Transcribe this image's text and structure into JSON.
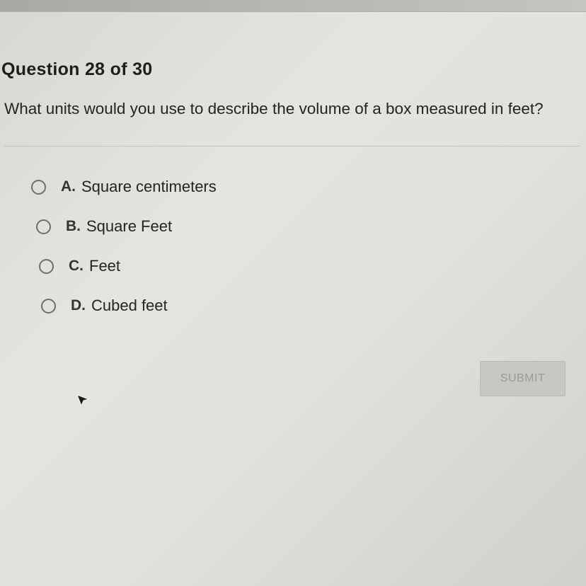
{
  "question": {
    "number_label": "Question 28 of 30",
    "text": "What units would you use to describe the volume of a box measured in feet?"
  },
  "options": [
    {
      "letter": "A.",
      "label": "Square centimeters",
      "selected": false
    },
    {
      "letter": "B.",
      "label": "Square Feet",
      "selected": false
    },
    {
      "letter": "C.",
      "label": "Feet",
      "selected": false
    },
    {
      "letter": "D.",
      "label": "Cubed feet",
      "selected": false
    }
  ],
  "submit": {
    "label": "SUBMIT",
    "enabled": false
  },
  "icons": {
    "radio": "radio-unchecked-icon",
    "cursor": "mouse-pointer-icon"
  },
  "colors": {
    "background": "#e2e0dc",
    "text": "#242424",
    "radio_border": "#6e6e6e",
    "submit_bg": "#c9c7c3",
    "submit_text": "#9c9a96"
  }
}
